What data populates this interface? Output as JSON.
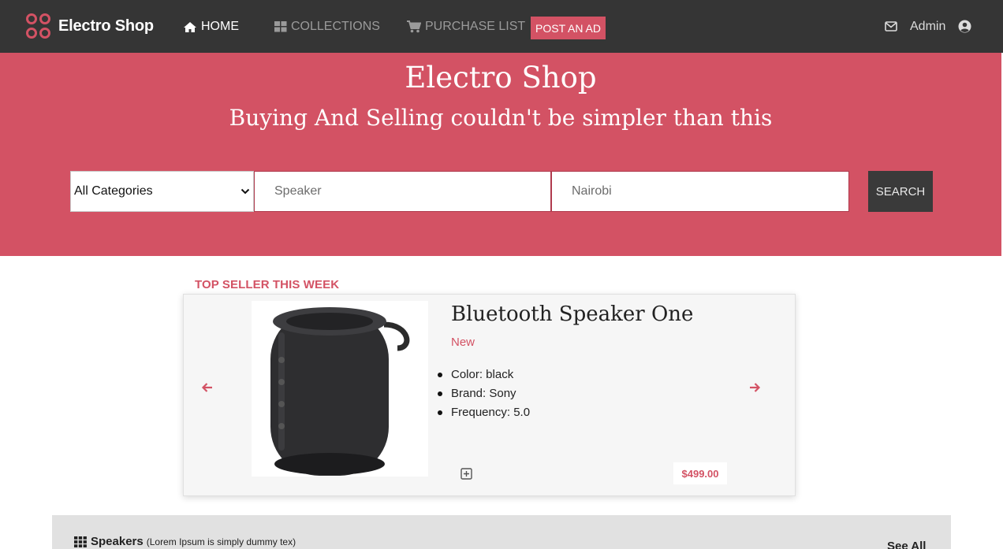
{
  "navbar": {
    "brand": "Electro Shop",
    "links": {
      "home": "HOME",
      "collections": "COLLECTIONS",
      "purchase_list": "PURCHASE LIST"
    },
    "post_ad": "POST AN AD",
    "user": "Admin",
    "icons": [
      "logo-icon",
      "home-icon",
      "grid-icon",
      "cart-icon",
      "mail-icon",
      "user-circle-icon"
    ]
  },
  "hero": {
    "title": "Electro Shop",
    "subtitle": "Buying And Selling couldn't be simpler than this",
    "search": {
      "category": "All Categories",
      "keyword": "Speaker",
      "location": "Nairobi",
      "button": "SEARCH"
    }
  },
  "top_seller": {
    "heading": "TOP SELLER THIS WEEK",
    "product": {
      "name": "Bluetooth Speaker One",
      "condition": "New",
      "specs": [
        "Color: black",
        "Brand: Sony",
        "Frequency: 5.0"
      ],
      "price": "$499.00"
    }
  },
  "category_section": {
    "title": "Speakers",
    "description": "(Lorem Ipsum is simply dummy tex)",
    "see_all": "See All"
  },
  "colors": {
    "accent": "#d35264",
    "navbar": "#353535",
    "search_button": "#3a3a3a"
  }
}
